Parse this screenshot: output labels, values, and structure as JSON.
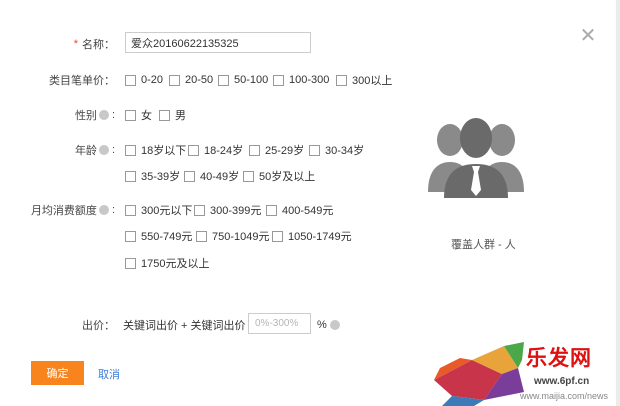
{
  "form": {
    "name_label": "名称：",
    "name_value": "爱众20160622135325",
    "unit_price_label": "类目笔单价：",
    "unit_price_options": [
      "0-20",
      "20-50",
      "50-100",
      "100-300",
      "300以上"
    ],
    "gender_label": "性别",
    "gender_options": [
      "女",
      "男"
    ],
    "age_label": "年龄",
    "age_options_row1": [
      "18岁以下",
      "18-24岁",
      "25-29岁",
      "30-34岁"
    ],
    "age_options_row2": [
      "35-39岁",
      "40-49岁",
      "50岁及以上"
    ],
    "spend_label": "月均消费额度",
    "spend_options_row1": [
      "300元以下",
      "300-399元",
      "400-549元"
    ],
    "spend_options_row2": [
      "550-749元",
      "750-1049元",
      "1050-1749元"
    ],
    "spend_options_row3": [
      "1750元及以上"
    ],
    "bid_label": "出价：",
    "bid_formula": "关键词出价 + 关键词出价 x",
    "bid_placeholder": "0%-300%",
    "bid_unit": "%"
  },
  "side": {
    "coverage_text": "覆盖人群 - 人"
  },
  "footer": {
    "ok_label": "确定",
    "cancel_label": "取消"
  },
  "watermark": {
    "title": "乐发网",
    "site1": "www.6pf.cn",
    "site2": "www.maijia.com/news"
  },
  "colors": {
    "accent": "#f7841d",
    "link": "#3b7dd8",
    "required": "#ee4433"
  },
  "icons": {
    "close": "close-icon",
    "avatar": "user-group-icon",
    "help": "help-icon"
  }
}
